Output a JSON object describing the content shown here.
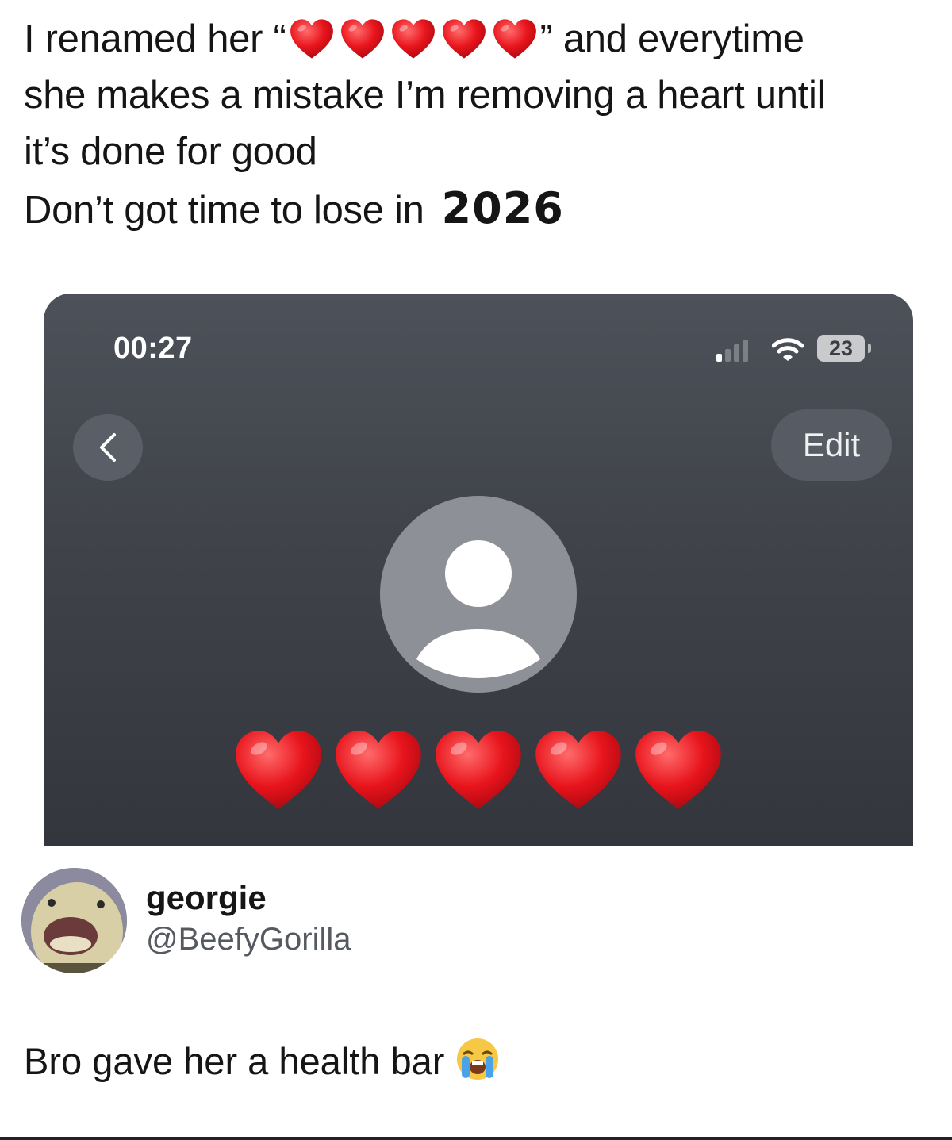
{
  "post": {
    "line1_pre": "I renamed her “",
    "line1_post": "” and everytime",
    "line2": "she makes a mistake I’m removing a heart until",
    "line3": "it’s done for good",
    "line4": "Don’t got time to lose in",
    "year": "2026",
    "heart_icons": [
      "red-heart-icon",
      "red-heart-icon",
      "red-heart-icon",
      "red-heart-icon",
      "red-heart-icon"
    ]
  },
  "phone": {
    "time": "00:27",
    "battery": "23",
    "edit_label": "Edit",
    "contact_hearts": [
      "red-heart-icon",
      "red-heart-icon",
      "red-heart-icon",
      "red-heart-icon",
      "red-heart-icon"
    ]
  },
  "reply": {
    "display_name": "georgie",
    "handle": "@BeefyGorilla",
    "text": "Bro gave her a health bar",
    "emoji": "loudly-crying-face-icon"
  },
  "colors": {
    "heart_red": "#e8141c",
    "phone_bg": "#42454c",
    "button_bg": "#585c64"
  }
}
